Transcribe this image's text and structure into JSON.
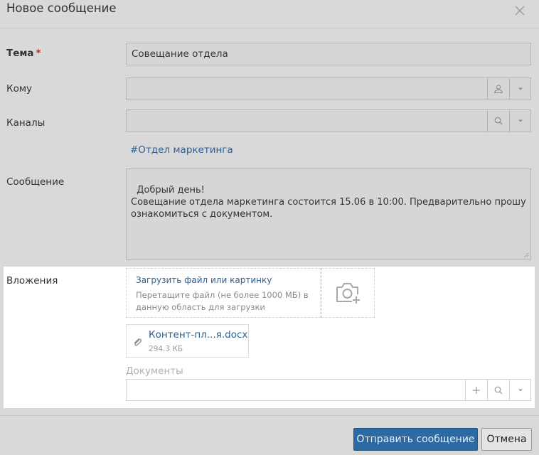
{
  "dialog": {
    "title": "Новое сообщение"
  },
  "subject": {
    "label": "Тема",
    "required_mark": "*",
    "value": "Совещание отдела"
  },
  "to": {
    "label": "Кому",
    "value": ""
  },
  "channels": {
    "label": "Каналы",
    "value": "",
    "selected_tag": "#Отдел маркетинга"
  },
  "message": {
    "label": "Сообщение",
    "value": "Добрый день!\nСовещание отдела маркетинга состоится 15.06 в 10:00. Предварительно прошу ознакомиться с документом."
  },
  "attachments": {
    "label": "Вложения",
    "upload_link": "Загрузить файл или картинку",
    "upload_hint": "Перетащите файл (не более 1000 МБ) в данную область для загрузки",
    "file": {
      "name": "Контент-пл...я.docx",
      "size": "294.3 КБ"
    }
  },
  "documents": {
    "label": "Документы",
    "value": ""
  },
  "footer": {
    "send_label": "Отправить сообщение",
    "cancel_label": "Отмена"
  },
  "colors": {
    "accent": "#2d6aa3",
    "link": "#2d5f91",
    "required": "#c8242b"
  }
}
